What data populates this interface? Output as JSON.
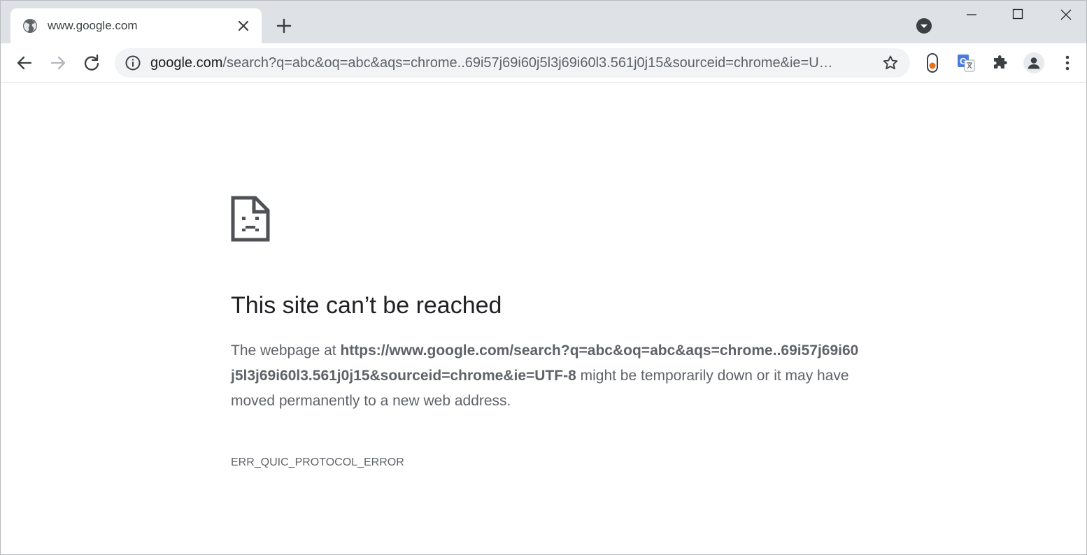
{
  "tab": {
    "title": "www.google.com",
    "favicon": "globe-icon"
  },
  "window_controls": [
    "minimize-icon",
    "maximize-icon",
    "close-icon"
  ],
  "omnibox": {
    "host": "google.com",
    "path": "/search?q=abc&oq=abc&aqs=chrome..69i57j69i60j5l3j69i60l3.561j0j15&sourceid=chrome&ie=U…"
  },
  "extensions": [
    "extension-orange-icon",
    "translate-icon",
    "puzzle-icon"
  ],
  "error": {
    "heading": "This site can’t be reached",
    "body_prefix": "The webpage at ",
    "url": "https://www.google.com/search?q=abc&oq=abc&aqs=chrome..69i57j69i60j5l3j69i60l3.561j0j15&sourceid=chrome&ie=UTF-8",
    "body_suffix": " might be temporarily down or it may have moved permanently to a new web address.",
    "code": "ERR_QUIC_PROTOCOL_ERROR"
  },
  "colors": {
    "tabstrip_bg": "#dee1e6",
    "omnibox_bg": "#f1f3f4",
    "icon_gray": "#5f6368",
    "heading_text": "#202124",
    "extension_orange": "#e8711a",
    "translate_blue": "#4a7ce0"
  }
}
